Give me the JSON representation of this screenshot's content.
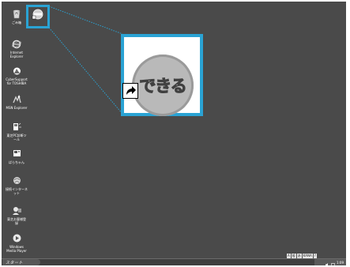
{
  "desktop": {
    "icons": [
      {
        "label": "ごみ箱",
        "icon": "recycle-bin-icon"
      },
      {
        "label": "Internet\nExplorer",
        "icon": "internet-explorer-icon"
      },
      {
        "label": "CyberSupport\nfor TOSHIBA",
        "icon": "cybersupport-icon"
      },
      {
        "label": "MSN Explorer",
        "icon": "msn-explorer-icon"
      },
      {
        "label": "東芝PC診断ツ\nール",
        "icon": "pc-diagnostic-tool-icon"
      },
      {
        "label": "ぱらちゃん",
        "icon": "parachan-icon"
      },
      {
        "label": "接続インターネ\nット",
        "icon": "internet-connect-icon"
      },
      {
        "label": "東芝お客様登\n録",
        "icon": "customer-registration-icon"
      },
      {
        "label": "Windows\nMedia Player",
        "icon": "windows-media-player-icon"
      }
    ],
    "shortcut_icon": {
      "label": "",
      "icon": "dekiru-shortcut-icon",
      "logo_text": "できる"
    }
  },
  "zoom_callout": {
    "logo_text": "できる",
    "arrow_icon": "shortcut-arrow-icon",
    "accent": "#2aa3d4"
  },
  "taskbar": {
    "start_label": "スタート",
    "clock": "1:09",
    "tray_icons": [
      "speaker-icon",
      "network-icon"
    ]
  },
  "langbar": {
    "items": [
      "A",
      "般",
      "あ",
      "KANA",
      "?"
    ]
  }
}
